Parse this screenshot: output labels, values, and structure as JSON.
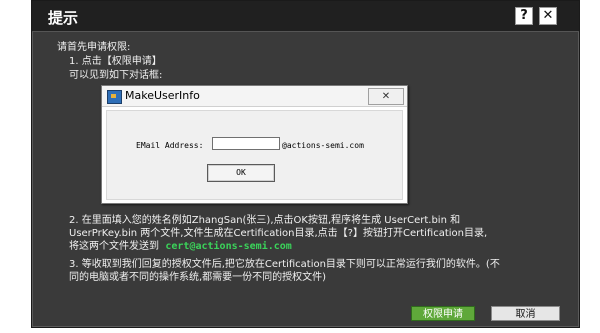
{
  "dialog": {
    "title": "提示",
    "help_label": "?",
    "close_label": "✕"
  },
  "content": {
    "intro": "请首先申请权限:",
    "step1_line1": "1. 点击【权限申请】",
    "step1_line2": "可以见到如下对话框:",
    "inner_dialog": {
      "title": "MakeUserInfo",
      "close_label": "✕",
      "email_label": "EMail Address:",
      "email_value": "",
      "email_suffix": "@actions-semi.com",
      "ok_label": "OK"
    },
    "step2_line1": "2. 在里面填入您的姓名例如ZhangSan(张三),点击OK按钮,程序将生成 UserCert.bin 和",
    "step2_line2": "UserPrKey.bin 两个文件,文件生成在Certification目录,点击【?】按钮打开Certification目录,",
    "step2_line3_prefix": "将这两个文件发送到",
    "step2_email": "cert@actions-semi.com",
    "step3_line1": "3. 等收取到我们回复的授权文件后,把它放在Certification目录下则可以正常运行我们的软件。(不",
    "step3_line2": "同的电脑或者不同的操作系统,都需要一份不同的授权文件)"
  },
  "footer": {
    "apply_label": "权限申请",
    "cancel_label": "取消"
  },
  "colors": {
    "dialog_bg": "#3a3a3a",
    "titlebar_bg": "#202020",
    "email_highlight": "#3bd35a",
    "apply_button": "#5fa83a"
  }
}
